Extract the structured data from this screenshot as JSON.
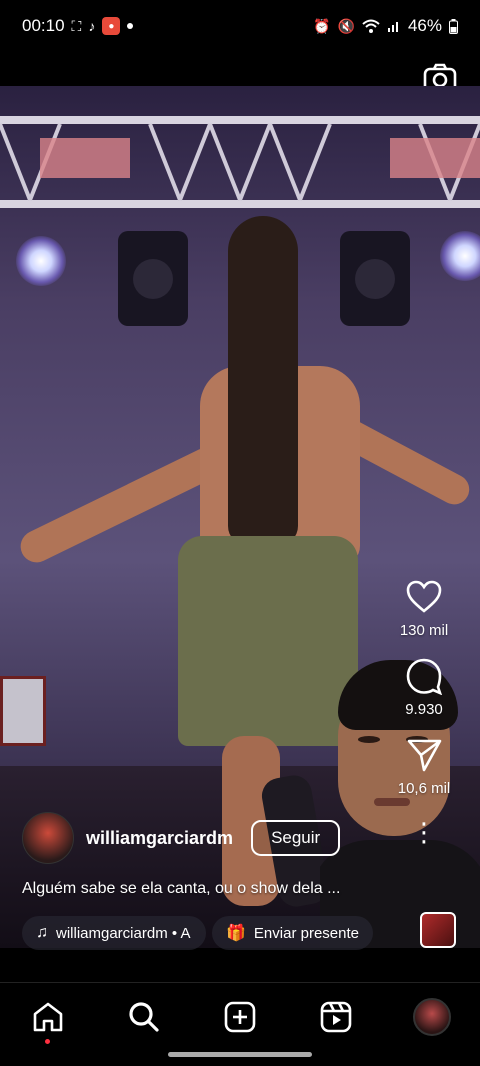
{
  "status_bar": {
    "time": "00:10",
    "battery": "46%",
    "left_icons": [
      "screen-capture-icon",
      "tiktok-icon",
      "app-notification-icon",
      "dot"
    ],
    "right_icons": [
      "alarm-icon",
      "mute-icon",
      "wifi-icon",
      "signal-icon",
      "battery-icon"
    ]
  },
  "reel": {
    "author": {
      "username": "williamgarciardm"
    },
    "follow_label": "Seguir",
    "caption": "Alguém sabe se ela canta, ou o show dela ...",
    "audio_label": "williamgarciardm • A",
    "gift_label": "Enviar presente",
    "likes": "130 mil",
    "comments": "9.930",
    "shares": "10,6 mil"
  },
  "nav": {
    "items": [
      "home-icon",
      "search-icon",
      "create-icon",
      "reels-icon",
      "profile-avatar"
    ]
  },
  "colors": {
    "accent_red": "#ff3040",
    "background": "#000000"
  }
}
